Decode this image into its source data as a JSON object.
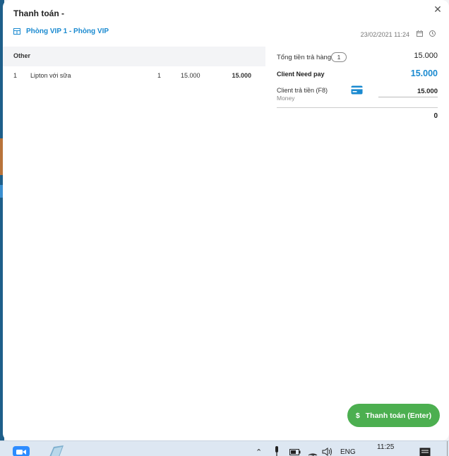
{
  "modal": {
    "title": "Thanh toán -",
    "room": "Phòng VIP 1 - Phòng VIP",
    "datetime": "23/02/2021 11:24"
  },
  "order": {
    "section": "Other",
    "items": [
      {
        "index": "1",
        "name": "Lipton với sữa",
        "qty": "1",
        "price": "15.000",
        "total": "15.000"
      }
    ]
  },
  "summary": {
    "total_label": "Tổng tiền trả hàng",
    "total_count": "1",
    "total_value": "15.000",
    "need_pay_label": "Client Need pay",
    "need_pay_value": "15.000",
    "paid_label": "Client trả tiền (F8)",
    "paid_method": "Money",
    "paid_value": "15.000",
    "change_value": "0"
  },
  "pay_button": {
    "icon": "$",
    "label": "Thanh toán (Enter)"
  },
  "taskbar": {
    "language": "ENG",
    "time": "11:25"
  },
  "colors": {
    "accent": "#1a8ad0",
    "pay_button": "#4caf50"
  }
}
